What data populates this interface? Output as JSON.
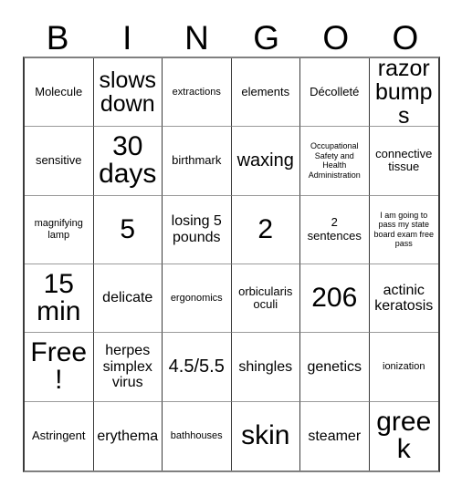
{
  "card": {
    "title": "Bingo Card",
    "header_letters": [
      "B",
      "I",
      "N",
      "G",
      "O",
      "O"
    ],
    "rows": 6,
    "columns": 6,
    "colors": {
      "background": "#ffffff",
      "text": "#000000",
      "vertical_gridline": "#3a3a3a",
      "horizontal_gridline": "#9a9a9a",
      "outer_border": "#808080"
    },
    "cells": [
      [
        {
          "text": "Molecule",
          "size": "sm"
        },
        {
          "text": "slows down",
          "size": "xl"
        },
        {
          "text": "extractions",
          "size": "xs"
        },
        {
          "text": "elements",
          "size": "sm"
        },
        {
          "text": "Décolleté",
          "size": "sm"
        },
        {
          "text": "razor bumps",
          "size": "xl"
        }
      ],
      [
        {
          "text": "sensitive",
          "size": "sm"
        },
        {
          "text": "30 days",
          "size": "xxl"
        },
        {
          "text": "birthmark",
          "size": "sm"
        },
        {
          "text": "waxing",
          "size": "lg"
        },
        {
          "text": "Occupational Safety and Health Administration",
          "size": "xxs"
        },
        {
          "text": "connective tissue",
          "size": "sm"
        }
      ],
      [
        {
          "text": "magnifying lamp",
          "size": "xs"
        },
        {
          "text": "5",
          "size": "xxl"
        },
        {
          "text": "losing 5 pounds",
          "size": "md"
        },
        {
          "text": "2",
          "size": "xxl"
        },
        {
          "text": "2 sentences",
          "size": "sm"
        },
        {
          "text": "I am going to pass my state board exam free pass",
          "size": "xxs"
        }
      ],
      [
        {
          "text": "15 min",
          "size": "xxl"
        },
        {
          "text": "delicate",
          "size": "md"
        },
        {
          "text": "ergonomics",
          "size": "xs"
        },
        {
          "text": "orbicularis oculi",
          "size": "sm"
        },
        {
          "text": "206",
          "size": "xxl"
        },
        {
          "text": "actinic keratosis",
          "size": "md"
        }
      ],
      [
        {
          "text": "Free!",
          "size": "xxl"
        },
        {
          "text": "herpes simplex virus",
          "size": "md"
        },
        {
          "text": "4.5/5.5",
          "size": "lg"
        },
        {
          "text": "shingles",
          "size": "md"
        },
        {
          "text": "genetics",
          "size": "md"
        },
        {
          "text": "ionization",
          "size": "xs"
        }
      ],
      [
        {
          "text": "Astringent",
          "size": "sm"
        },
        {
          "text": "erythema",
          "size": "md"
        },
        {
          "text": "bathhouses",
          "size": "xs"
        },
        {
          "text": "skin",
          "size": "xxl"
        },
        {
          "text": "steamer",
          "size": "md"
        },
        {
          "text": "greek",
          "size": "xxl"
        }
      ]
    ]
  }
}
